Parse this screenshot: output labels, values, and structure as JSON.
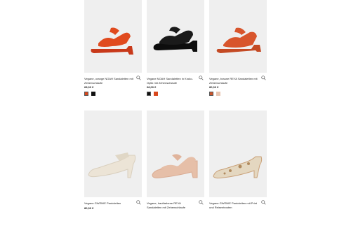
{
  "products": [
    {
      "name": "Vegane, orange NOAH Sandaletten mit Zehenschlaufe",
      "price": "68,00 €",
      "colors": [
        "#d8471c",
        "#111111"
      ],
      "shoe_color": "#e04a1e",
      "sole_color": "#c8391a"
    },
    {
      "name": "Vegane NOAH Sandaletten in Kroko-Optik mit Zehenschlaufe",
      "price": "68,00 €",
      "colors": [
        "#111111",
        "#d8471c"
      ],
      "shoe_color": "#1a1a1a",
      "sole_color": "#0d0d0d"
    },
    {
      "name": "Vegane, braune REYA Sandaletten mit Zehenschlaufe",
      "price": "80,00 €",
      "colors": [
        "#c9542c",
        "#e8c4b0"
      ],
      "shoe_color": "#d8552c",
      "sole_color": "#c44a24"
    },
    {
      "name": "Vegane GWENIE Pantoletten",
      "price": "80,00 €",
      "colors": [],
      "shoe_color": "#ece4d6",
      "sole_color": "#d9cfbe"
    },
    {
      "name": "Vegane, hautfarbene REYA Sandaletten mit Zehenschlaufe",
      "price": "",
      "colors": [],
      "shoe_color": "#e6bfa8",
      "sole_color": "#d9ab92"
    },
    {
      "name": "Vegane GWENIE Pantoletten mit Print und Reisentrosten",
      "price": "",
      "colors": [],
      "shoe_color": "#e4d7c0",
      "sole_color": "#caa27a"
    }
  ]
}
